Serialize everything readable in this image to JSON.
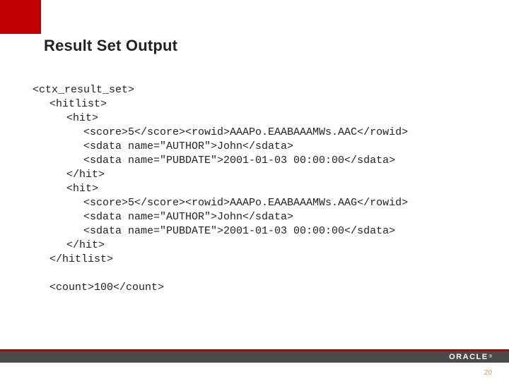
{
  "title": "Result Set Output",
  "code": {
    "l0": "<ctx_result_set>",
    "l1": "<hitlist>",
    "l2": "<hit>",
    "l3": "<score>5</score><rowid>AAAPo.EAABAAAMWs.AAC</rowid>",
    "l4": "<sdata name=\"AUTHOR\">John</sdata>",
    "l5": "<sdata name=\"PUBDATE\">2001-01-03 00:00:00</sdata>",
    "l6": "</hit>",
    "l7": "<hit>",
    "l8": "<score>5</score><rowid>AAAPo.EAABAAAMWs.AAG</rowid>",
    "l9": "<sdata name=\"AUTHOR\">John</sdata>",
    "l10": "<sdata name=\"PUBDATE\">2001-01-03 00:00:00</sdata>",
    "l11": "</hit>",
    "l12": "</hitlist>",
    "l13": "",
    "l14": "<count>100</count>"
  },
  "logo": "ORACLE",
  "page_number": "20"
}
